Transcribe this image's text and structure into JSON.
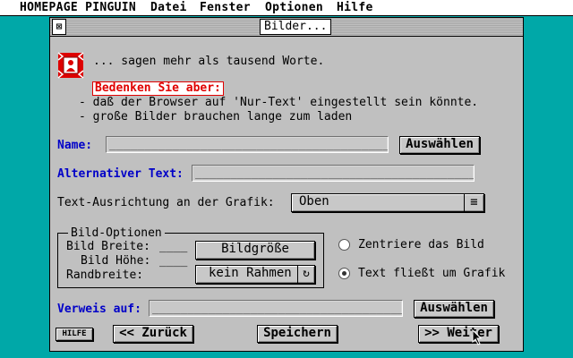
{
  "menubar": {
    "items": [
      "HOMEPAGE PINGUIN",
      "Datei",
      "Fenster",
      "Optionen",
      "Hilfe"
    ]
  },
  "window": {
    "title": "Bilder..."
  },
  "intro": {
    "headline": "... sagen mehr als tausend Worte.",
    "warning": "Bedenken Sie aber:",
    "bullet1": "- daß der Browser auf 'Nur-Text' eingestellt sein könnte.",
    "bullet2": "- große Bilder brauchen lange zum laden"
  },
  "name_field": {
    "label": "Name:",
    "value": "________________________________________________",
    "button": "Auswählen"
  },
  "alt_text_field": {
    "label": "Alternativer Text:",
    "value": "_________________________________________________"
  },
  "alignment": {
    "label": "Text-Ausrichtung an der Grafik:",
    "selected": "Oben",
    "dropdown_icon": "≡"
  },
  "options_group": {
    "title": "Bild-Optionen",
    "width_label": "Bild Breite:",
    "width_value": "____",
    "height_label": "Bild Höhe:",
    "height_value": "____",
    "border_label": "Randbreite:",
    "size_button": "Bildgröße",
    "border_button": "kein Rahmen",
    "border_cycle_icon": "↻"
  },
  "layout_options": {
    "center_label": "Zentriere das Bild",
    "center_selected": false,
    "flow_label": "Text fließt um Grafik",
    "flow_selected": true
  },
  "link_field": {
    "label": "Verweis auf:",
    "value": "___________________________________________________",
    "button": "Auswählen"
  },
  "footer": {
    "help_button": "HILFE",
    "back_button": "<< Zurück",
    "save_button": "Speichern",
    "next_button": ">> Weiter"
  }
}
